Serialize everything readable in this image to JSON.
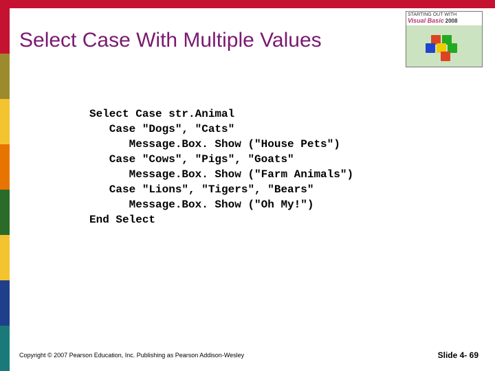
{
  "title": "Select Case With Multiple Values",
  "logo": {
    "product_line1": "STARTING OUT WITH",
    "product_line2": "Visual Basic",
    "year": "2008"
  },
  "code": {
    "l1": "Select Case str.Animal",
    "l2": "   Case \"Dogs\", \"Cats\"",
    "l3": "      Message.Box. Show (\"House Pets\")",
    "l4": "   Case \"Cows\", \"Pigs\", \"Goats\"",
    "l5": "      Message.Box. Show (\"Farm Animals\")",
    "l6": "   Case \"Lions\", \"Tigers\", \"Bears\"",
    "l7": "      Message.Box. Show (\"Oh My!\")",
    "l8": "End Select"
  },
  "footer": "Copyright © 2007 Pearson Education, Inc. Publishing as Pearson Addison-Wesley",
  "slide_number": "Slide 4- 69"
}
